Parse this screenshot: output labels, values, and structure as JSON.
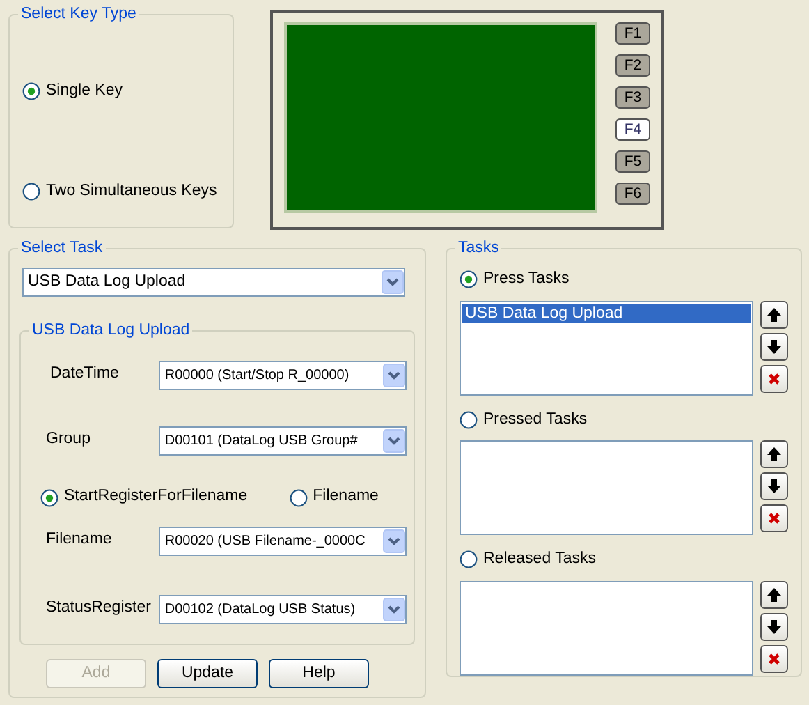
{
  "key_type": {
    "title": "Select Key Type",
    "options": [
      {
        "label": "Single Key",
        "selected": true
      },
      {
        "label": "Two Simultaneous Keys",
        "selected": false
      }
    ]
  },
  "function_keys": [
    {
      "label": "F1",
      "selected": false
    },
    {
      "label": "F2",
      "selected": false
    },
    {
      "label": "F3",
      "selected": false
    },
    {
      "label": "F4",
      "selected": true
    },
    {
      "label": "F5",
      "selected": false
    },
    {
      "label": "F6",
      "selected": false
    }
  ],
  "select_task": {
    "title": "Select Task",
    "value": "USB Data Log Upload",
    "settings": {
      "title": "USB Data Log Upload",
      "rows": [
        {
          "kind": "dropdown",
          "label": "DateTime",
          "value": "R00000 (Start/Stop R_00000)"
        },
        {
          "kind": "dropdown",
          "label": "Group",
          "value": "D00101 (DataLog USB Group#"
        },
        {
          "kind": "radio",
          "options": [
            {
              "label": "StartRegisterForFilename",
              "selected": true
            },
            {
              "label": "Filename",
              "selected": false
            }
          ]
        },
        {
          "kind": "dropdown",
          "label": "Filename",
          "value": "R00020 (USB Filename-_0000C"
        },
        {
          "kind": "dropdown",
          "label": "StatusRegister",
          "value": "D00102 (DataLog USB Status)"
        }
      ]
    },
    "buttons": [
      {
        "label": "Add",
        "disabled": true
      },
      {
        "label": "Update",
        "disabled": false
      },
      {
        "label": "Help",
        "disabled": false
      }
    ]
  },
  "tasks": {
    "title": "Tasks",
    "lists": [
      {
        "label": "Press Tasks",
        "selected": true,
        "items": [
          {
            "label": "USB Data Log Upload",
            "selected": true
          }
        ]
      },
      {
        "label": "Pressed Tasks",
        "selected": false
      },
      {
        "label": "Released Tasks",
        "selected": false
      }
    ]
  }
}
